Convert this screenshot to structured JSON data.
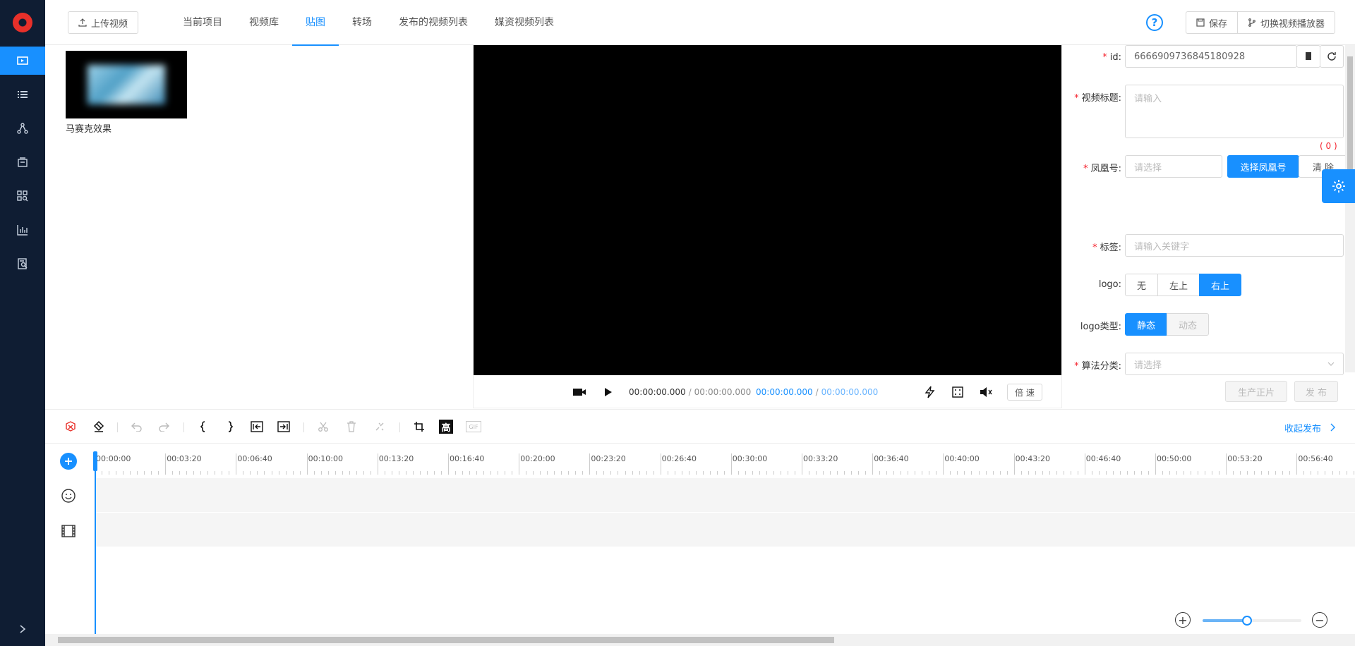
{
  "header": {
    "upload_label": "上传视频",
    "tabs": [
      {
        "label": "当前项目"
      },
      {
        "label": "视频库"
      },
      {
        "label": "贴图",
        "active": true
      },
      {
        "label": "转场"
      },
      {
        "label": "发布的视频列表"
      },
      {
        "label": "媒资视频列表"
      }
    ],
    "help_icon": "?",
    "save_label": "保存",
    "switch_player_label": "切换视频播放器"
  },
  "library": {
    "items": [
      {
        "label": "马赛克效果"
      }
    ]
  },
  "player": {
    "current_time": "00:00:00.000",
    "separator": "/",
    "total_time": "00:00:00.000",
    "range_start": "00:00:00.000",
    "range_end": "00:00:00.000",
    "speed_label": "倍 速"
  },
  "form": {
    "id": {
      "label": "id:",
      "value": "6666909736845180928"
    },
    "title": {
      "label": "视频标题:",
      "placeholder": "请输入",
      "counter": "( 0 )"
    },
    "account": {
      "label": "凤凰号:",
      "placeholder": "请选择",
      "select_label": "选择凤凰号",
      "clear_label": "清 除"
    },
    "tags": {
      "label": "标签:",
      "placeholder": "请输入关键字"
    },
    "logo": {
      "label": "logo:",
      "options": [
        "无",
        "左上",
        "右上"
      ],
      "selected": "右上"
    },
    "logo_type": {
      "label": "logo类型:",
      "options": [
        "静态",
        "动态"
      ],
      "selected": "静态"
    },
    "algo": {
      "label": "算法分类:",
      "placeholder": "请选择"
    },
    "produce_label": "生产正片",
    "publish_label": "发 布",
    "required_mark": "*"
  },
  "toolbar": {
    "gif_label": "GIF",
    "hd_label": "高",
    "collapse_label": "收起发布"
  },
  "timeline": {
    "ticks": [
      "00:00:00",
      "00:03:20",
      "00:06:40",
      "00:10:00",
      "00:13:20",
      "00:16:40",
      "00:20:00",
      "00:23:20",
      "00:26:40",
      "00:30:00",
      "00:33:20",
      "00:36:40",
      "00:40:00",
      "00:43:20",
      "00:46:40",
      "00:50:00",
      "00:53:20",
      "00:56:40"
    ],
    "zoom_plus": "+",
    "zoom_minus": "−",
    "zoom_level": 0.45
  },
  "colors": {
    "accent": "#1890ff",
    "nav_bg": "#0f1d33",
    "danger": "#f5222d"
  }
}
